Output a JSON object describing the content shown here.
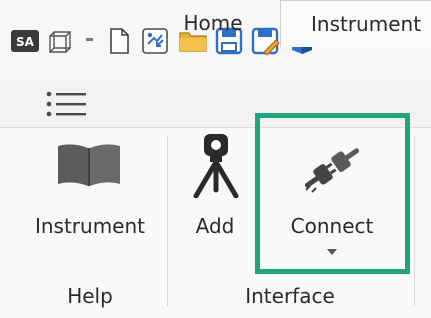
{
  "toolbar": {
    "items": [
      {
        "icon": "sa-app-icon",
        "label": "SA"
      },
      {
        "icon": "3d-cube-icon"
      },
      {
        "icon": "new-file-icon"
      },
      {
        "icon": "open-file-icon"
      },
      {
        "icon": "folder-icon"
      },
      {
        "icon": "save-icon"
      },
      {
        "icon": "save-as-icon"
      },
      {
        "icon": "blue-cube-icon"
      }
    ]
  },
  "tabs": [
    {
      "label": "Home"
    },
    {
      "label": "Instrument"
    }
  ],
  "ribbon": {
    "groups": [
      {
        "label": "Help",
        "buttons": [
          {
            "label": "Instrument",
            "icon": "book-icon"
          }
        ]
      },
      {
        "label": "Interface",
        "buttons": [
          {
            "label": "Add",
            "icon": "tripod-instrument-icon"
          },
          {
            "label": "Connect",
            "icon": "plug-connect-icon"
          }
        ]
      }
    ]
  },
  "colors": {
    "highlight": "#20a57d",
    "accent_blue": "#2f6fc4"
  }
}
